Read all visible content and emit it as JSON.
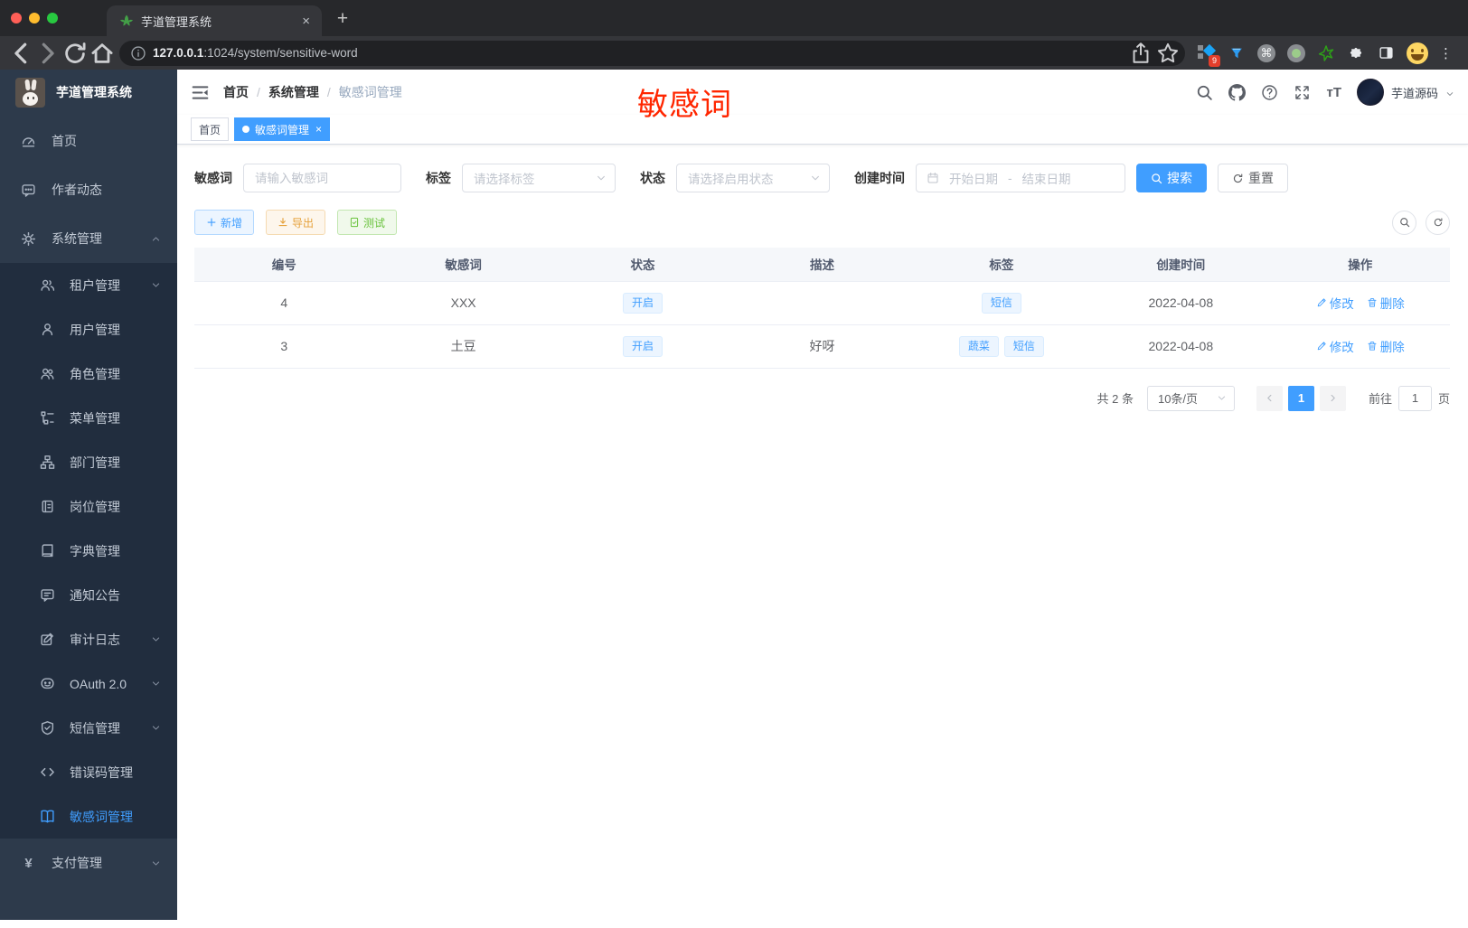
{
  "browser": {
    "tab_title": "芋道管理系统",
    "url_host": "127.0.0.1",
    "url_path": ":1024/system/sensitive-word",
    "new_tab_label": "+",
    "tab_close_label": "×",
    "menu_dots": "⋮",
    "extension_icons": [
      {
        "name": "bookmark-diamond-icon",
        "badge": "9"
      },
      {
        "name": "funnel-icon"
      },
      {
        "name": "command-icon",
        "glyph": "⌘"
      },
      {
        "name": "record-icon"
      },
      {
        "name": "green-star-icon"
      },
      {
        "name": "puzzle-icon"
      },
      {
        "name": "side-panel-icon"
      },
      {
        "name": "emoji-avatar"
      }
    ]
  },
  "sidebar": {
    "logo_title": "芋道管理系统",
    "items": [
      {
        "label": "首页",
        "icon": "dashboard-icon",
        "level": 1
      },
      {
        "label": "作者动态",
        "icon": "message-icon",
        "level": 1
      },
      {
        "label": "系统管理",
        "icon": "gear-icon",
        "level": 1,
        "arrow": "up"
      },
      {
        "label": "租户管理",
        "icon": "tenant-icon",
        "level": 2,
        "arrow": "down"
      },
      {
        "label": "用户管理",
        "icon": "user-icon",
        "level": 2
      },
      {
        "label": "角色管理",
        "icon": "role-icon",
        "level": 2
      },
      {
        "label": "菜单管理",
        "icon": "menu-tree-icon",
        "level": 2
      },
      {
        "label": "部门管理",
        "icon": "org-icon",
        "level": 2
      },
      {
        "label": "岗位管理",
        "icon": "post-icon",
        "level": 2
      },
      {
        "label": "字典管理",
        "icon": "dict-icon",
        "level": 2
      },
      {
        "label": "通知公告",
        "icon": "notice-icon",
        "level": 2
      },
      {
        "label": "审计日志",
        "icon": "log-icon",
        "level": 2,
        "arrow": "down"
      },
      {
        "label": "OAuth 2.0",
        "icon": "oauth-icon",
        "level": 2,
        "arrow": "down"
      },
      {
        "label": "短信管理",
        "icon": "sms-shield-icon",
        "level": 2,
        "arrow": "down"
      },
      {
        "label": "错误码管理",
        "icon": "code-icon",
        "level": 2
      },
      {
        "label": "敏感词管理",
        "icon": "book-open-icon",
        "level": 2,
        "active": true
      },
      {
        "label": "支付管理",
        "icon": "pay-icon",
        "level": 1,
        "arrow": "down"
      }
    ]
  },
  "header": {
    "breadcrumb": [
      "首页",
      "系统管理",
      "敏感词管理"
    ],
    "annotation": "敏感词",
    "username": "芋道源码"
  },
  "tabs": [
    {
      "label": "首页",
      "active": false
    },
    {
      "label": "敏感词管理",
      "active": true,
      "close": "×"
    }
  ],
  "filters": {
    "keyword_label": "敏感词",
    "keyword_placeholder": "请输入敏感词",
    "tag_label": "标签",
    "tag_placeholder": "请选择标签",
    "status_label": "状态",
    "status_placeholder": "请选择启用状态",
    "date_label": "创建时间",
    "date_start": "开始日期",
    "date_sep": "-",
    "date_end": "结束日期",
    "search_label": "搜索",
    "reset_label": "重置"
  },
  "toolbar": {
    "add_label": "新增",
    "export_label": "导出",
    "test_label": "测试"
  },
  "table": {
    "headers": [
      "编号",
      "敏感词",
      "状态",
      "描述",
      "标签",
      "创建时间",
      "操作"
    ],
    "rows": [
      {
        "id": "4",
        "word": "XXX",
        "status": "开启",
        "description": "",
        "tags": [
          "短信"
        ],
        "created": "2022-04-08"
      },
      {
        "id": "3",
        "word": "土豆",
        "status": "开启",
        "description": "好呀",
        "tags": [
          "蔬菜",
          "短信"
        ],
        "created": "2022-04-08"
      }
    ],
    "edit_label": "修改",
    "delete_label": "删除"
  },
  "pagination": {
    "total": "共 2 条",
    "page_size": "10条/页",
    "current_page": "1",
    "goto_label": "前往",
    "goto_value": "1",
    "page_unit": "页"
  },
  "colors": {
    "accent": "#409eff",
    "success": "#67c23a",
    "warning": "#e6a23c",
    "annotation_red": "#ff2600",
    "sidebar_bg": "#2d3a4b",
    "submenu_bg": "#212d3e",
    "tag_bg": "#ecf5ff"
  }
}
